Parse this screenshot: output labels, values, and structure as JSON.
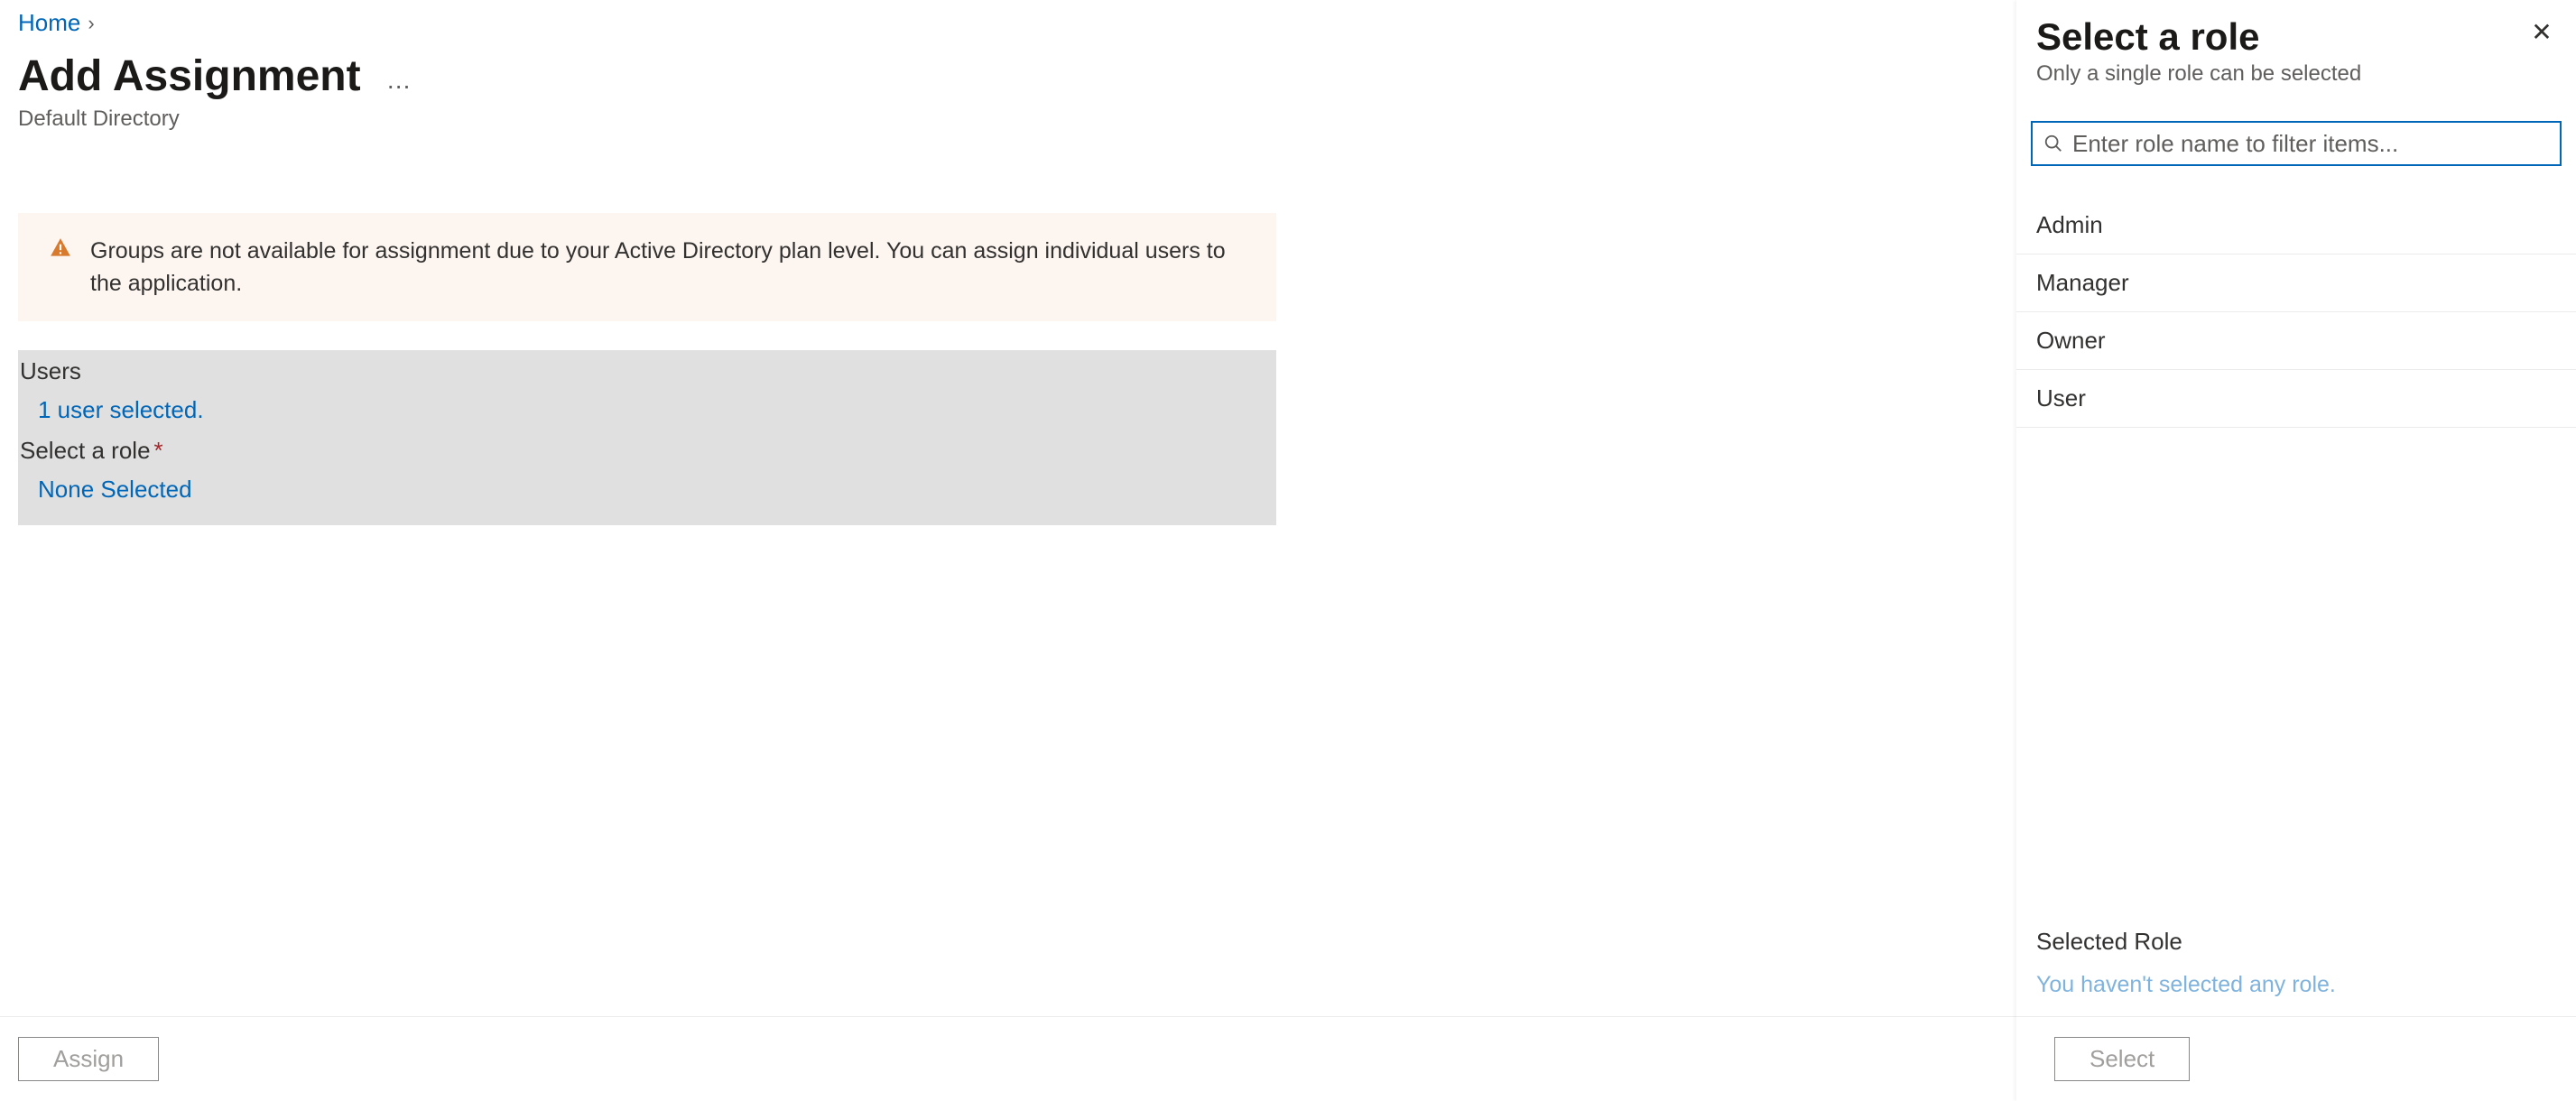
{
  "breadcrumb": {
    "home": "Home"
  },
  "page": {
    "title": "Add Assignment",
    "subtitle": "Default Directory"
  },
  "warning": {
    "text": "Groups are not available for assignment due to your Active Directory plan level. You can assign individual users to the application."
  },
  "form": {
    "users_label": "Users",
    "users_value": "1 user selected.",
    "role_label": "Select a role",
    "role_value": "None Selected"
  },
  "buttons": {
    "assign": "Assign",
    "select": "Select"
  },
  "panel": {
    "title": "Select a role",
    "subtitle": "Only a single role can be selected",
    "search_placeholder": "Enter role name to filter items...",
    "roles": [
      "Admin",
      "Manager",
      "Owner",
      "User"
    ],
    "selected_label": "Selected Role",
    "selected_value": "You haven't selected any role."
  }
}
